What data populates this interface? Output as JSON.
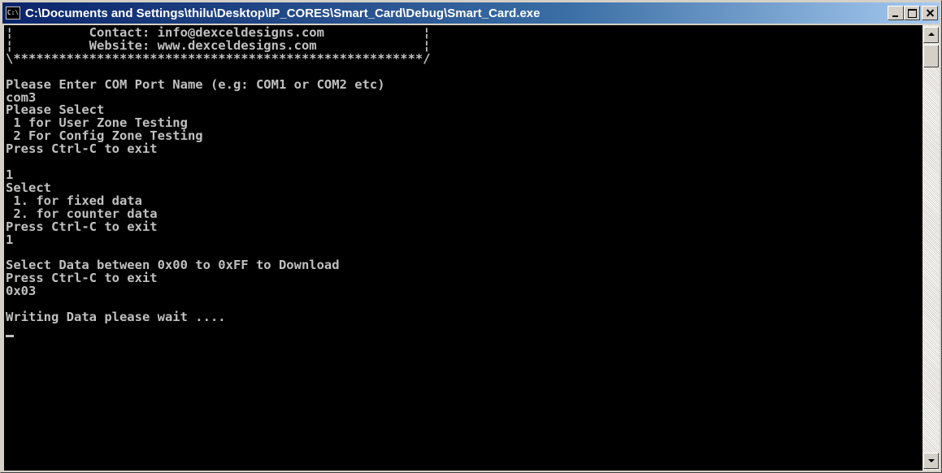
{
  "window": {
    "title": "C:\\Documents and Settings\\thilu\\Desktop\\IP_CORES\\Smart_Card\\Debug\\Smart_Card.exe",
    "icon": "console-icon",
    "icon_text": "C:\\"
  },
  "console": {
    "lines": [
      "¦          Contact: info@dexceldesigns.com             ¦",
      "¦          Website: www.dexceldesigns.com              ¦",
      "\\******************************************************/",
      "",
      "Please Enter COM Port Name (e.g: COM1 or COM2 etc)",
      "com3",
      "Please Select",
      " 1 for User Zone Testing",
      " 2 For Config Zone Testing",
      "Press Ctrl-C to exit",
      "",
      "1",
      "Select",
      " 1. for fixed data",
      " 2. for counter data",
      "Press Ctrl-C to exit",
      "1",
      "",
      "Select Data between 0x00 to 0xFF to Download",
      "Press Ctrl-C to exit",
      "0x03",
      "",
      "Writing Data please wait ....",
      ""
    ]
  },
  "colors": {
    "console_bg": "#000000",
    "console_fg": "#c0c0c0",
    "title_gradient_start": "#0a246a",
    "title_gradient_end": "#a6caf0"
  },
  "scrollbar": {
    "up_icon": "arrow-up-icon",
    "down_icon": "arrow-down-icon"
  }
}
